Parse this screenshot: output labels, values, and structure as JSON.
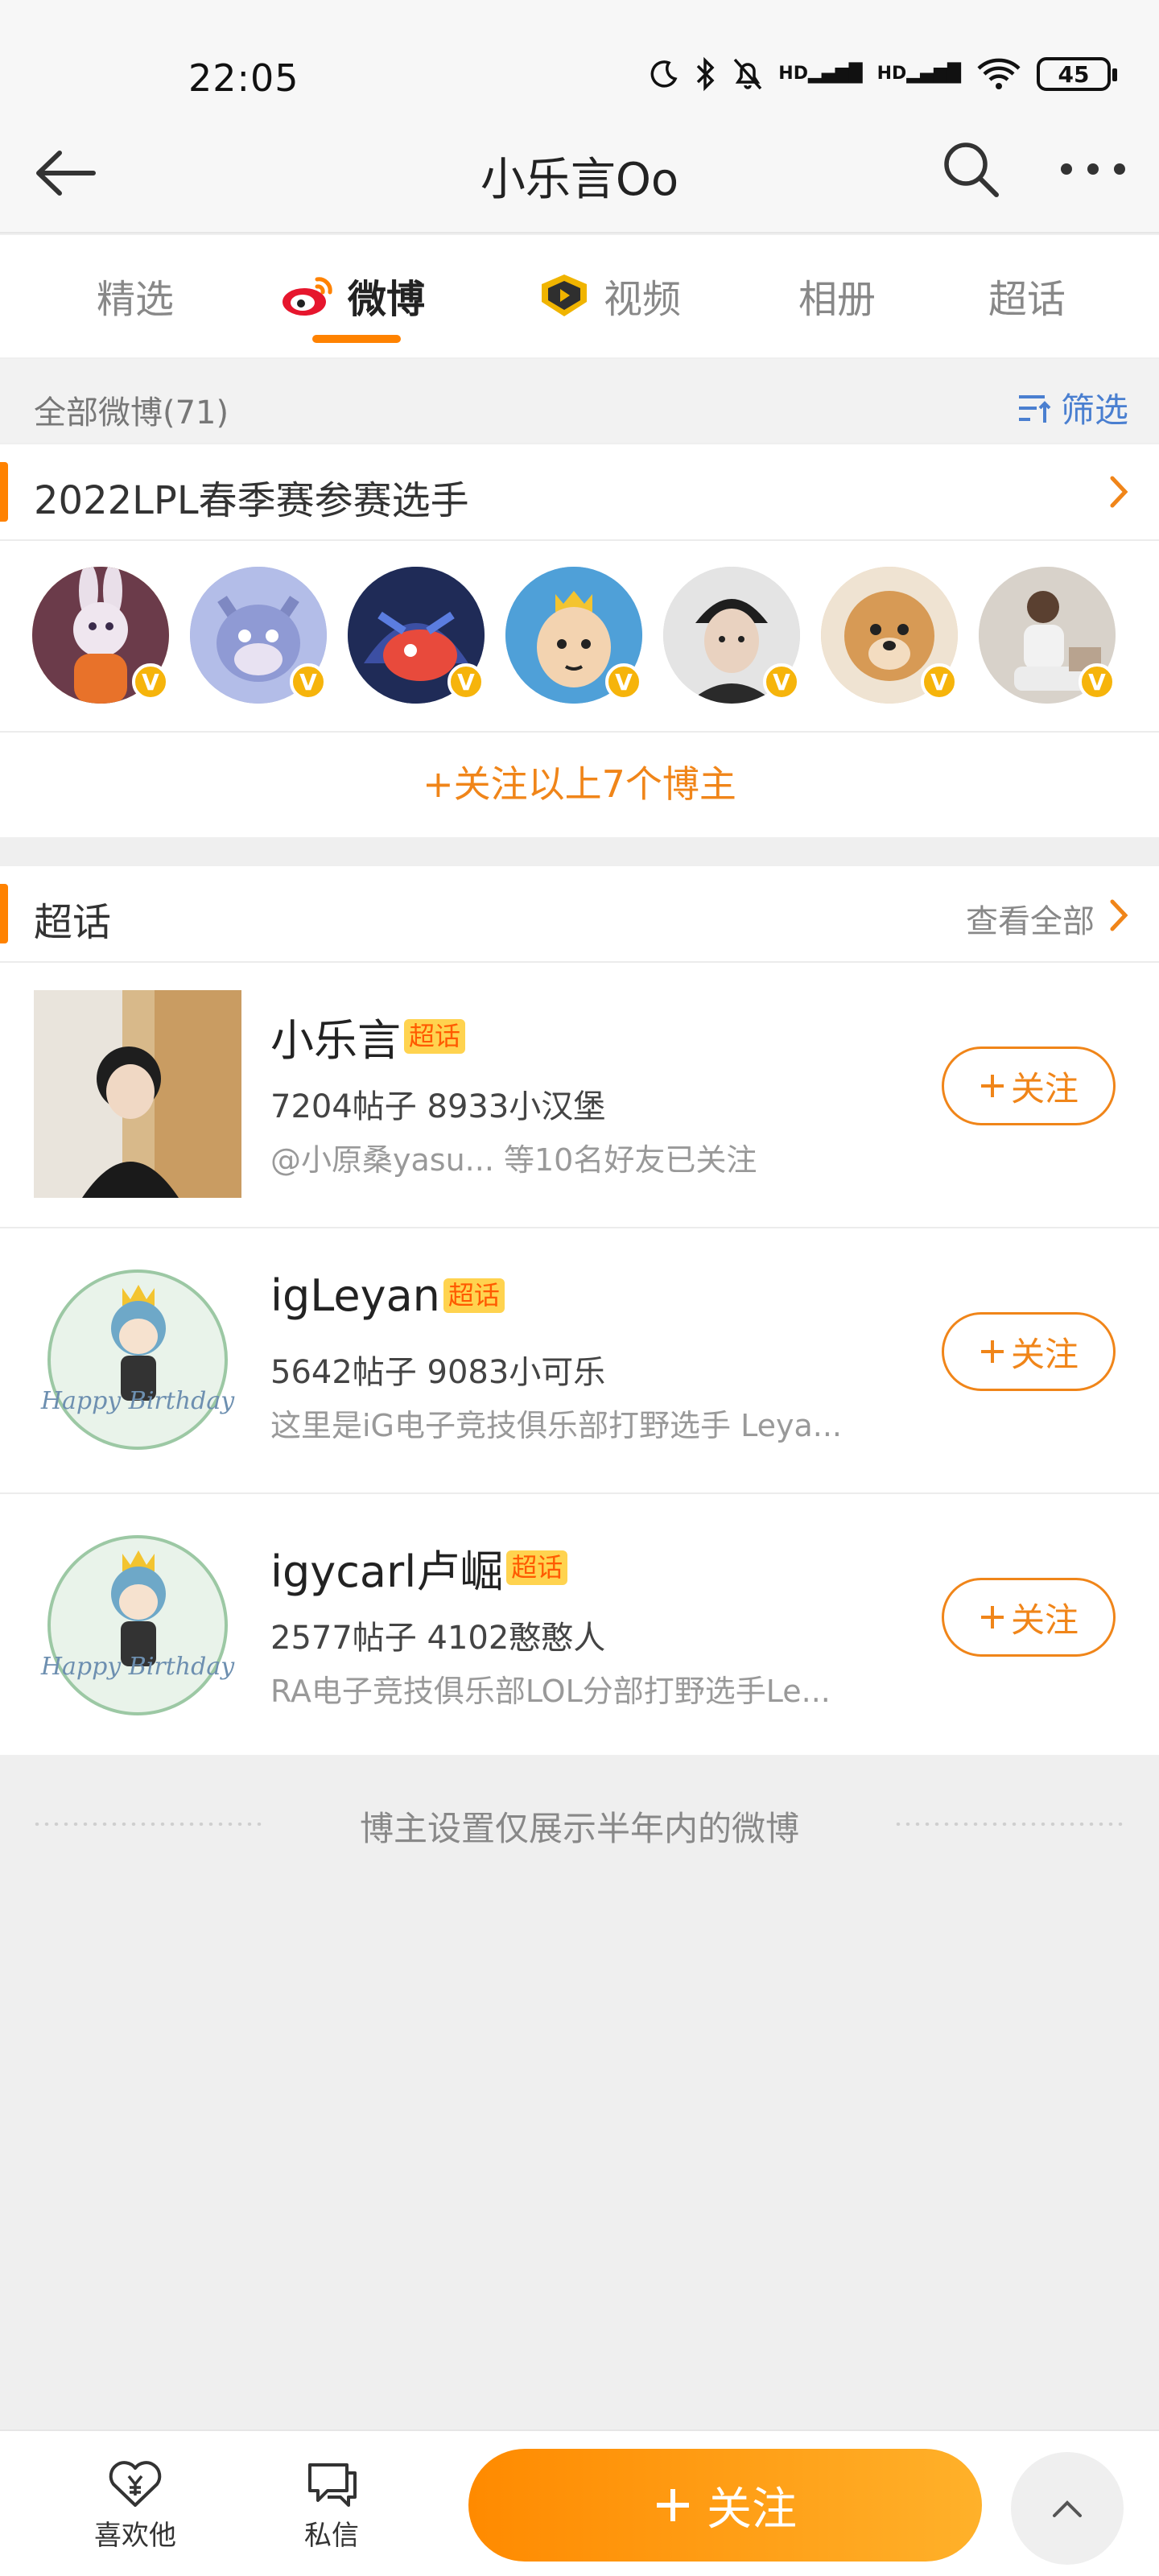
{
  "status_bar": {
    "time": "22:05",
    "battery": "45"
  },
  "header": {
    "title": "小乐言Oo"
  },
  "tabs": [
    {
      "label": "精选",
      "active": false
    },
    {
      "label": "微博",
      "active": true
    },
    {
      "label": "视频",
      "active": false
    },
    {
      "label": "相册",
      "active": false
    },
    {
      "label": "超话",
      "active": false
    }
  ],
  "filter": {
    "count_label": "全部微博(71)",
    "filter_label": "筛选"
  },
  "group": {
    "title": "2022LPL春季赛参赛选手",
    "follow_all": "+关注以上7个博主",
    "avatars": [
      {
        "icon": "bunny-avatar",
        "color": "#c8875a"
      },
      {
        "icon": "cat-cartoon-avatar",
        "color": "#9aa6d8"
      },
      {
        "icon": "game-character-avatar",
        "color": "#2a3a6b"
      },
      {
        "icon": "king-cartoon-avatar",
        "color": "#4fa0d8"
      },
      {
        "icon": "man-portrait-avatar",
        "color": "#cfcfcf"
      },
      {
        "icon": "dog-avatar",
        "color": "#e9c79c"
      },
      {
        "icon": "man-sitting-avatar",
        "color": "#d9d3cc"
      }
    ]
  },
  "supertopics": {
    "title": "超话",
    "see_all": "查看全部",
    "badge": "超话",
    "follow_label": "关注",
    "items": [
      {
        "name": "小乐言",
        "stats": "7204帖子  8933小汉堡",
        "desc": "@小原桑yasu... 等10名好友已关注"
      },
      {
        "name": "igLeyan",
        "stats": "5642帖子  9083小可乐",
        "desc": "这里是iG电子竞技俱乐部打野选手 Leya..."
      },
      {
        "name": "igycarl卢崛",
        "stats": "2577帖子  4102憨憨人",
        "desc": "RA电子竞技俱乐部LOL分部打野选手Le..."
      }
    ],
    "birthday_text": "Happy Birthday"
  },
  "notice": "博主设置仅展示半年内的微博",
  "bottom_bar": {
    "like_label": "喜欢他",
    "message_label": "私信",
    "follow_label": "关注"
  }
}
